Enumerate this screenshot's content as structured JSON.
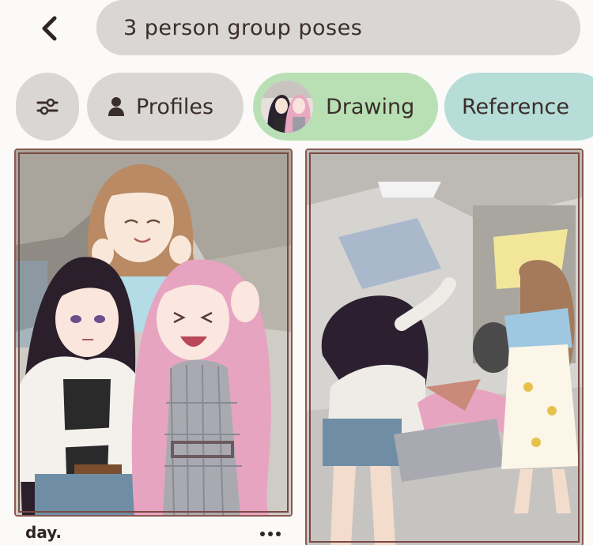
{
  "search": {
    "query": "3 person group poses"
  },
  "filters": {
    "profiles_label": "Profiles",
    "drawing_label": "Drawing",
    "reference_label": "Reference"
  },
  "pins": [
    {
      "caption": "day."
    }
  ],
  "icons": {
    "back": "chevron-left-icon",
    "filter": "sliders-icon",
    "profile": "person-icon",
    "more": "ellipsis-icon"
  },
  "colors": {
    "chip_gray": "#d9d6d3",
    "chip_drawing": "#b9e0b4",
    "chip_reference": "#b6ddd8",
    "text": "#3a2e2b"
  }
}
